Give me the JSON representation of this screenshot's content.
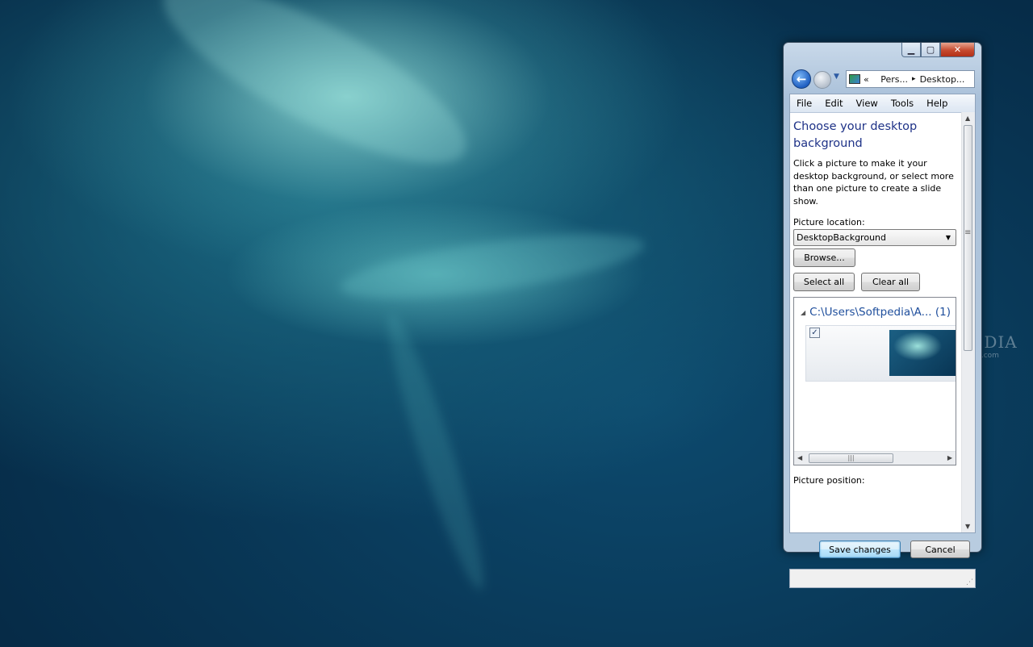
{
  "watermark": {
    "brand": "SOFTPEDIA",
    "url": "www.softpedia.com"
  },
  "window": {
    "caption": {
      "minimize_icon": "minimize-icon",
      "maximize_icon": "maximize-icon",
      "close_icon": "close-icon"
    },
    "nav": {
      "back_icon": "back-arrow-icon",
      "forward_icon": "forward-arrow-icon",
      "address": {
        "chevron": "«",
        "crumb1": "Pers...",
        "crumb2": "Desktop...",
        "separator": "▸"
      }
    },
    "menu": {
      "items": [
        "File",
        "Edit",
        "View",
        "Tools",
        "Help"
      ]
    },
    "content": {
      "heading": "Choose your desktop background",
      "description": "Click a picture to make it your desktop background, or select more than one picture to create a slide show.",
      "picture_location_label": "Picture location:",
      "picture_location_value": "DesktopBackground",
      "browse_label": "Browse...",
      "select_all_label": "Select all",
      "clear_all_label": "Clear all",
      "group_header": "C:\\Users\\Softpedia\\A... (1)",
      "thumbnail_checked": true,
      "picture_position_label": "Picture position:"
    },
    "footer": {
      "save_label": "Save changes",
      "cancel_label": "Cancel"
    }
  },
  "colors": {
    "heading": "#1e3287",
    "group_header": "#1e4e9c",
    "desktop_bg": "#0d4a6e"
  }
}
